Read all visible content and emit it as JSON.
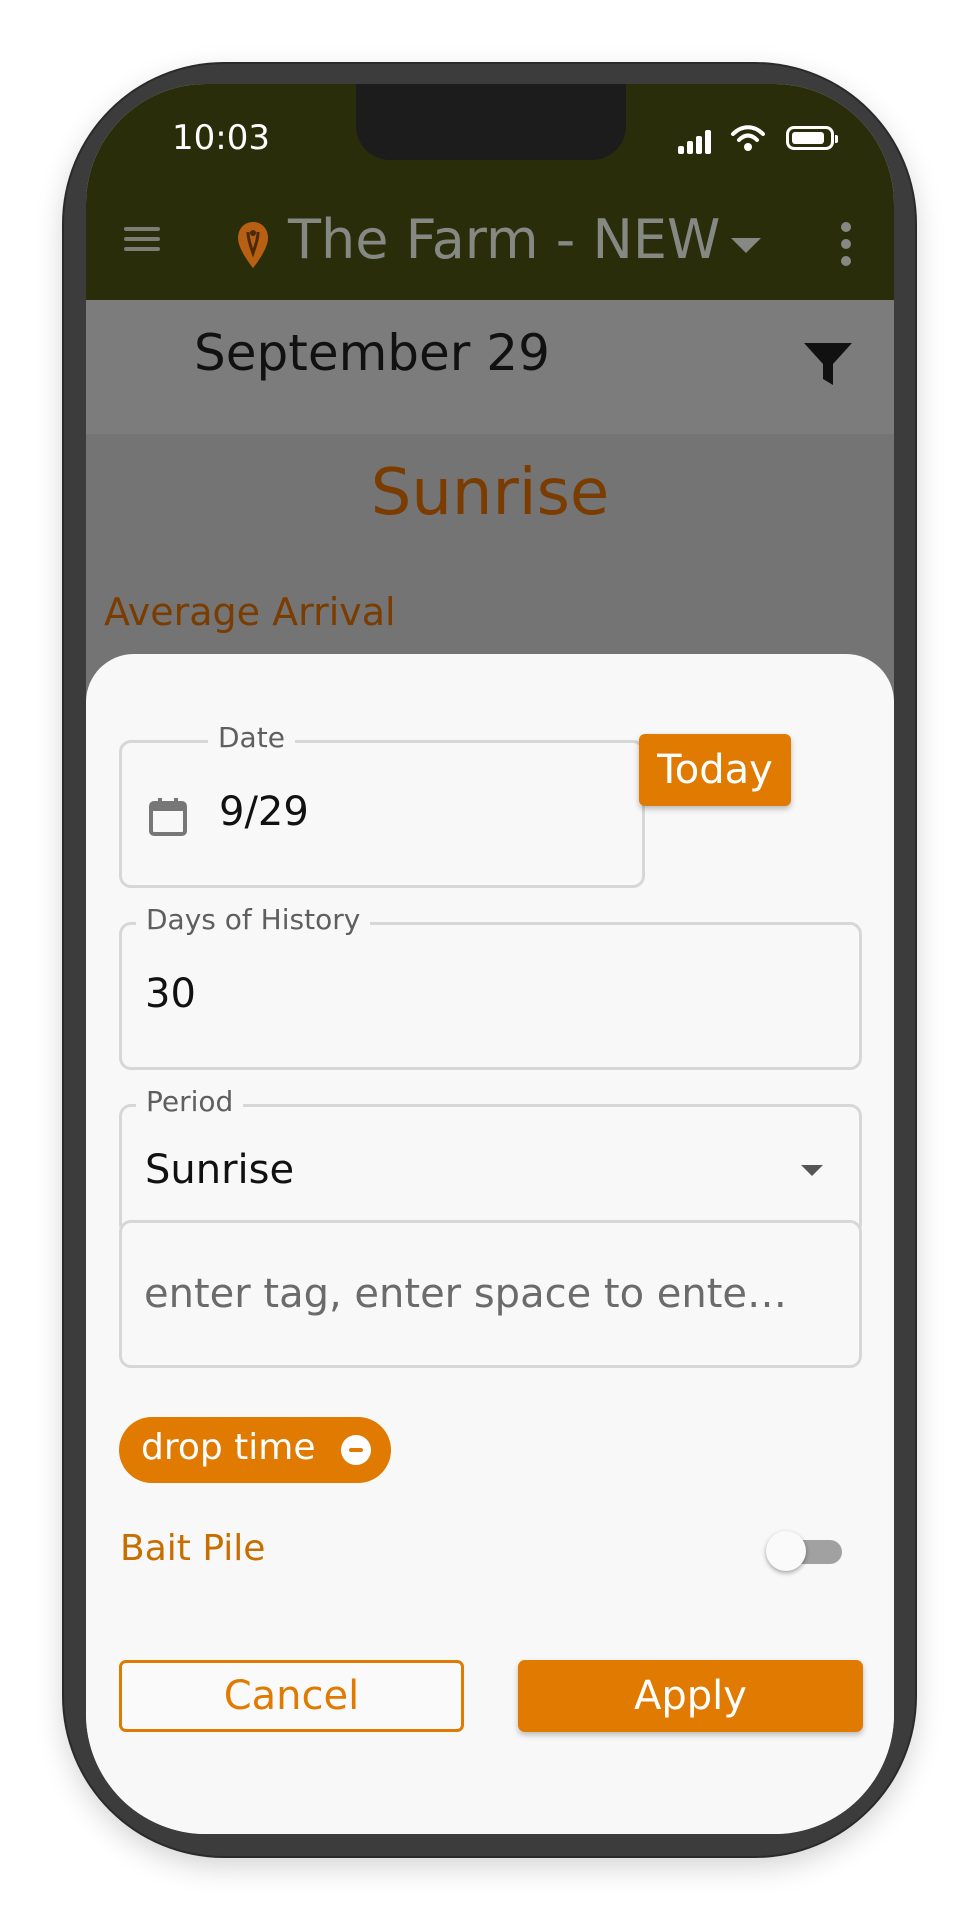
{
  "status_bar": {
    "time": "10:03"
  },
  "app_bar": {
    "title": "The Farm - NEW",
    "icons": {
      "menu": "menu-icon",
      "location": "location-pin-icon",
      "dropdown": "chevron-down-icon",
      "more": "more-vertical-icon"
    }
  },
  "date_header": {
    "title": "September 29",
    "filter_icon": "filter-icon"
  },
  "page": {
    "period_heading": "Sunrise",
    "average_arrival_heading": "Average Arrival"
  },
  "filter_sheet": {
    "date_field": {
      "label": "Date",
      "value": "9/29",
      "icon": "calendar-icon"
    },
    "today_button": "Today",
    "days_of_history": {
      "label": "Days of History",
      "value": "30"
    },
    "period": {
      "label": "Period",
      "selected": "Sunrise",
      "caret_icon": "dropdown-caret-icon"
    },
    "tag_input": {
      "placeholder": "enter tag, enter space to ente…"
    },
    "tag_chips": [
      {
        "label": "drop time",
        "icon": "remove-icon"
      }
    ],
    "bait_pile_toggle": {
      "label": "Bait Pile",
      "enabled": false
    },
    "cancel_button": "Cancel",
    "apply_button": "Apply"
  },
  "colors": {
    "accent": "#e07a00",
    "app_bar": "#2a2d0a",
    "text_dark": "#111111"
  }
}
